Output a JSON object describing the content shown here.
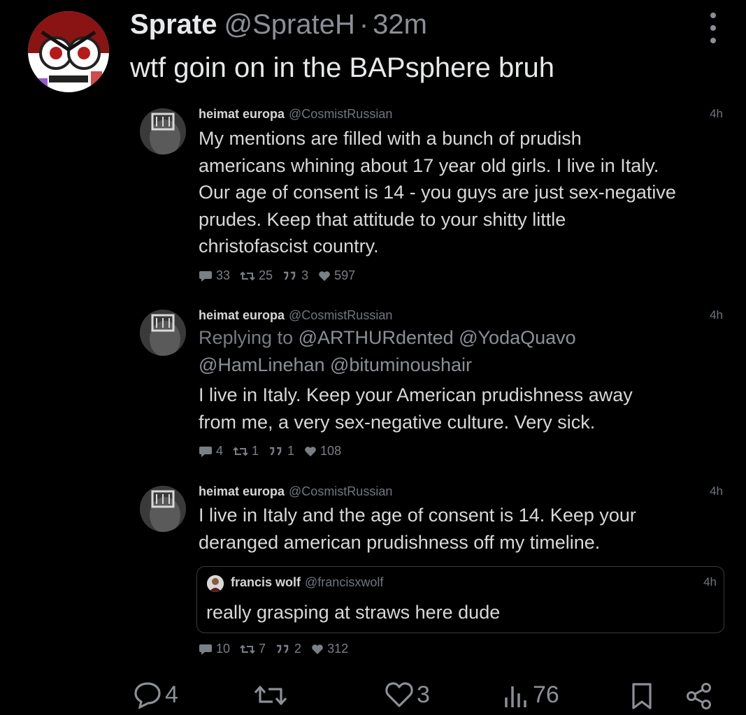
{
  "tweet": {
    "display_name": "Sprate",
    "handle": "@SprateH",
    "separator": "·",
    "time": "32m",
    "text": "wtf goin on in the BAPsphere bruh"
  },
  "embedded": [
    {
      "name": "heimat europa",
      "handle": "@CosmistRussian",
      "time": "4h",
      "lines": [
        "My mentions are filled with a bunch of prudish",
        "americans whining about 17 year old girls.  I live in Italy.",
        "Our age of consent is 14 - you guys are just sex-negative",
        "prudes.  Keep that attitude to your shitty little",
        "christofascist country."
      ],
      "stats": {
        "replies": "33",
        "retweets": "25",
        "quotes": "3",
        "likes": "597"
      }
    },
    {
      "name": "heimat europa",
      "handle": "@CosmistRussian",
      "time": "4h",
      "replying_to_label": "Replying to",
      "replying_line1": "@ARTHURdented @YodaQuavo",
      "replying_line2": "@HamLinehan @bituminoushair",
      "lines": [
        "I live in Italy.  Keep your American prudishness away",
        "from me, a very sex-negative culture.   Very sick."
      ],
      "stats": {
        "replies": "4",
        "retweets": "1",
        "quotes": "1",
        "likes": "108"
      }
    },
    {
      "name": "heimat europa",
      "handle": "@CosmistRussian",
      "time": "4h",
      "lines": [
        "I live in Italy and the age of consent is 14.  Keep your",
        "deranged american prudishness off my timeline."
      ],
      "quote": {
        "name": "francis wolf",
        "handle": "@francisxwolf",
        "time": "4h",
        "text": "really grasping at straws here dude"
      },
      "stats": {
        "replies": "10",
        "retweets": "7",
        "quotes": "2",
        "likes": "312"
      }
    }
  ],
  "actions": {
    "replies": "4",
    "likes": "3",
    "views": "76"
  },
  "colors": {
    "background": "#000000",
    "primary_text": "#e7e9ea",
    "secondary_text": "#8b9096"
  }
}
